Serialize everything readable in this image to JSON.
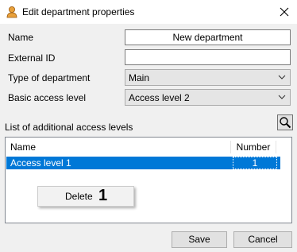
{
  "window": {
    "title": "Edit department properties"
  },
  "form": {
    "name_label": "Name",
    "name_value": "New department",
    "external_id_label": "External ID",
    "external_id_value": "",
    "type_label": "Type of department",
    "type_value": "Main",
    "access_label": "Basic access level",
    "access_value": "Access level 2"
  },
  "list": {
    "label": "List of additional access levels",
    "columns": [
      "Name",
      "Number"
    ],
    "rows": [
      {
        "name": "Access level 1",
        "number": "1"
      }
    ]
  },
  "context_menu": {
    "item": "Delete",
    "marker": "1"
  },
  "buttons": {
    "save": "Save",
    "cancel": "Cancel"
  },
  "colors": {
    "selection": "#0078d7",
    "dialog_bg": "#f0f0f0"
  }
}
